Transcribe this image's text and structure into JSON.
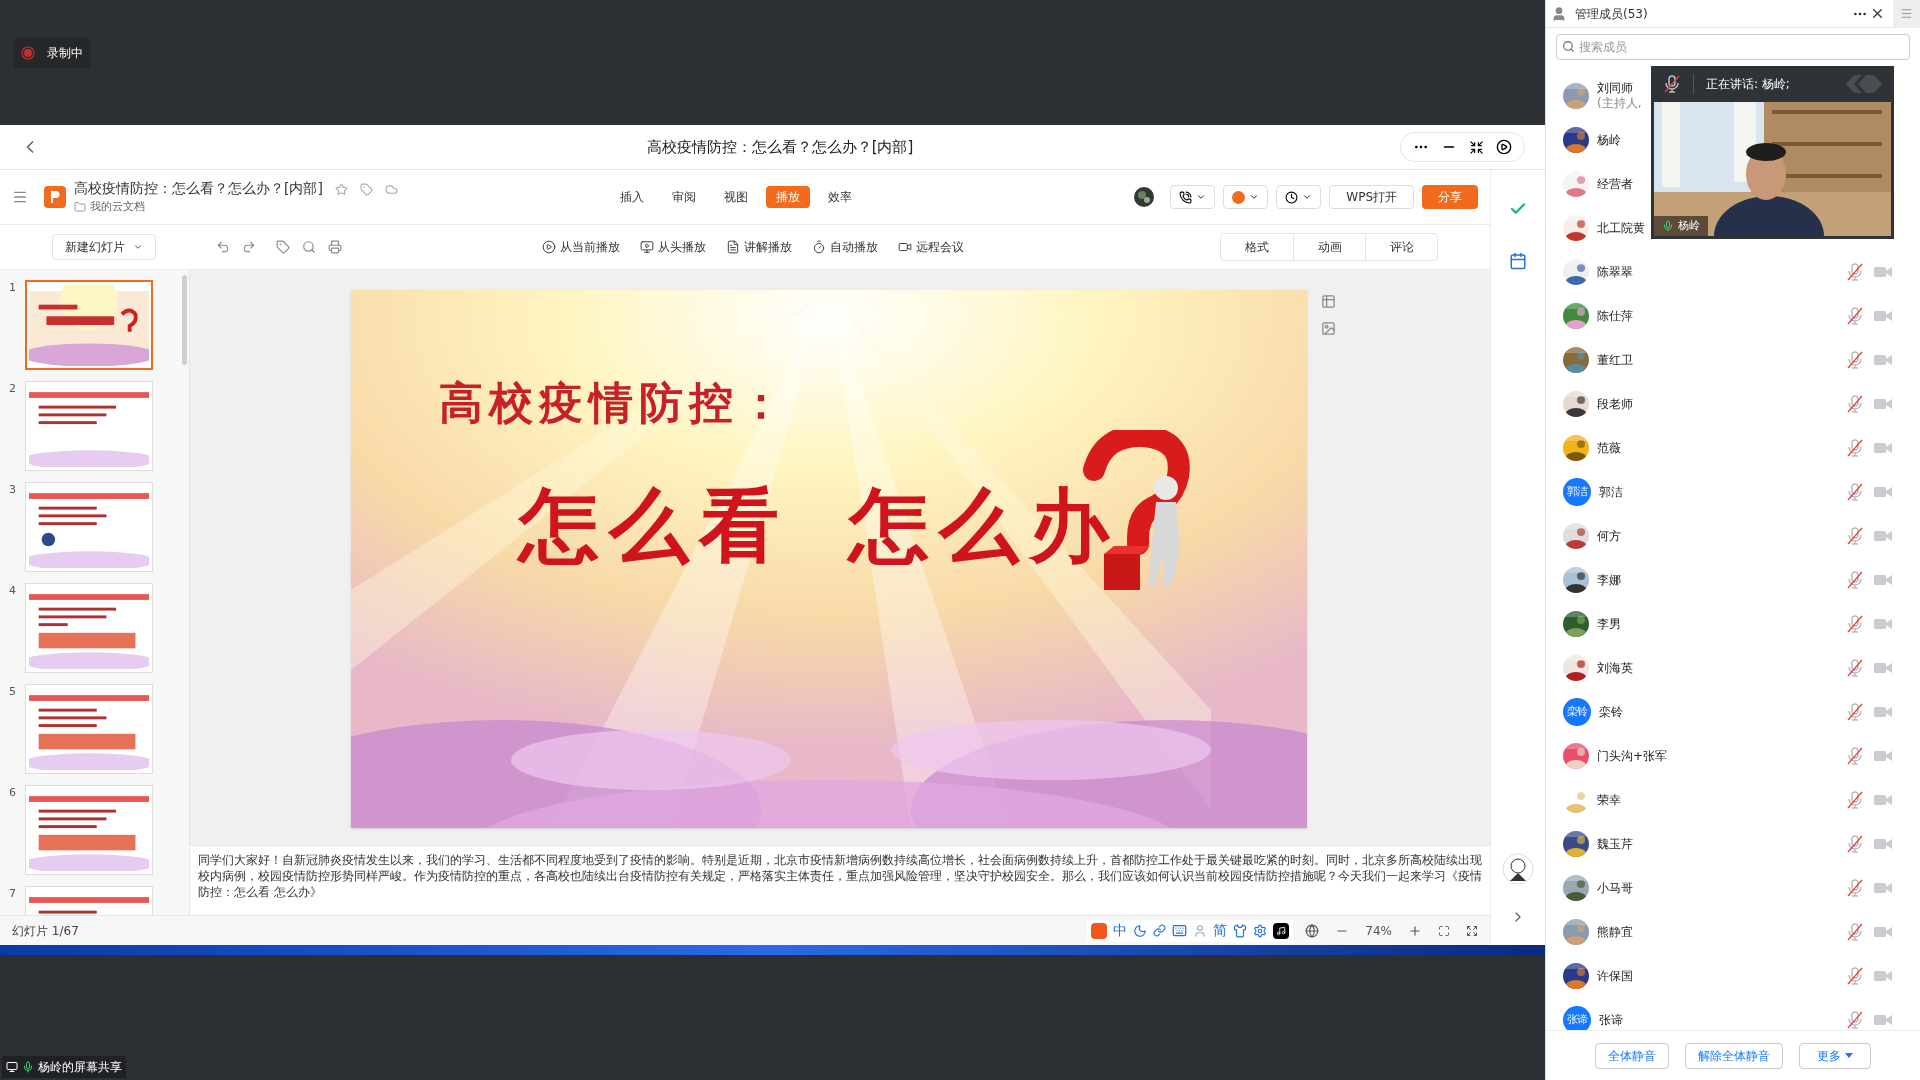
{
  "recording": {
    "label": "录制中"
  },
  "window": {
    "title": "高校疫情防控：怎么看？怎么办？[内部]"
  },
  "doc": {
    "title": "高校疫情防控：怎么看？怎么办？[内部]",
    "location": "我的云文档"
  },
  "menu_tabs": [
    {
      "label": "插入",
      "selected": false
    },
    {
      "label": "审阅",
      "selected": false
    },
    {
      "label": "视图",
      "selected": false
    },
    {
      "label": "播放",
      "selected": true
    },
    {
      "label": "效率",
      "selected": false
    }
  ],
  "header_buttons": [
    {
      "label": "WPS打开",
      "kind": "outline"
    },
    {
      "label": "分享",
      "kind": "primary"
    }
  ],
  "toolbar": {
    "new_slide": "新建幻灯片",
    "play_actions": [
      {
        "label": "从当前播放",
        "kind": "play"
      },
      {
        "label": "从头播放",
        "kind": "screen"
      },
      {
        "label": "讲解播放",
        "kind": "narrate"
      },
      {
        "label": "自动播放",
        "kind": "auto"
      },
      {
        "label": "远程会议",
        "kind": "meeting"
      }
    ],
    "panel_tabs": [
      "格式",
      "动画",
      "评论"
    ]
  },
  "thumbnails": [
    {
      "number": "1",
      "selected": true
    },
    {
      "number": "2",
      "selected": false
    },
    {
      "number": "3",
      "selected": false
    },
    {
      "number": "4",
      "selected": false
    },
    {
      "number": "5",
      "selected": false
    },
    {
      "number": "6",
      "selected": false
    },
    {
      "number": "7",
      "selected": false
    }
  ],
  "slide": {
    "title": "高校疫情防控：",
    "subtitle_parts": [
      "怎么看",
      "怎么办"
    ]
  },
  "notes": "同学们大家好！自新冠肺炎疫情发生以来，我们的学习、生活都不同程度地受到了疫情的影响。特别是近期，北京市疫情新增病例数持续高位增长，社会面病例数持续上升，首都防控工作处于最关键最吃紧的时刻。同时，北京多所高校陆续出现校内病例，校园疫情防控形势同样严峻。作为疫情防控的重点，各高校也陆续出台疫情防控有关规定，严格落实主体责任，重点加强风险管理，坚决守护校园安全。那么，我们应该如何认识当前校园疫情防控措施呢？今天我们一起来学习《疫情防控：怎么看 怎么办》",
  "status": {
    "slide_count": "幻灯片 1/67",
    "ime": [
      "中",
      "简"
    ],
    "zoom": "74%"
  },
  "screen_share": {
    "label": "杨岭的屏幕共享"
  },
  "members_panel": {
    "title": "管理成员(53)",
    "search_placeholder": "搜索成员",
    "speaking": {
      "label": "正在讲话: 杨岭;",
      "video_name": "杨岭"
    },
    "members": [
      {
        "name": "刘同师",
        "note": "(主持人,",
        "kind": "picture"
      },
      {
        "name": "杨岭",
        "kind": "picture"
      },
      {
        "name": "经营者",
        "kind": "picture"
      },
      {
        "name": "北工院黄",
        "kind": "picture"
      },
      {
        "name": "陈翠翠",
        "kind": "picture",
        "muted": true
      },
      {
        "name": "陈仕萍",
        "kind": "picture",
        "muted": true
      },
      {
        "name": "董红卫",
        "kind": "picture",
        "muted": true
      },
      {
        "name": "段老师",
        "kind": "picture",
        "muted": true
      },
      {
        "name": "范薇",
        "kind": "picture",
        "muted": true
      },
      {
        "name": "郭洁",
        "kind": "text",
        "avatar_text": "郭洁",
        "muted": true
      },
      {
        "name": "何方",
        "kind": "picture",
        "muted": true
      },
      {
        "name": "李娜",
        "kind": "picture",
        "muted": true
      },
      {
        "name": "李男",
        "kind": "picture",
        "muted": true
      },
      {
        "name": "刘海英",
        "kind": "picture",
        "muted": true
      },
      {
        "name": "栾铃",
        "kind": "text",
        "avatar_text": "栾铃",
        "muted": true
      },
      {
        "name": "门头沟+张军",
        "kind": "picture",
        "muted": true
      },
      {
        "name": "荣幸",
        "kind": "picture",
        "muted": true
      },
      {
        "name": "魏玉芹",
        "kind": "picture",
        "muted": true
      },
      {
        "name": "小马哥",
        "kind": "picture",
        "muted": true
      },
      {
        "name": "熊静宜",
        "kind": "picture",
        "muted": true
      },
      {
        "name": "许保国",
        "kind": "picture",
        "muted": true
      },
      {
        "name": "张谛",
        "kind": "text",
        "avatar_text": "张谛",
        "muted": true
      }
    ],
    "buttons": [
      "全体静音",
      "解除全体静音",
      "更多"
    ]
  }
}
